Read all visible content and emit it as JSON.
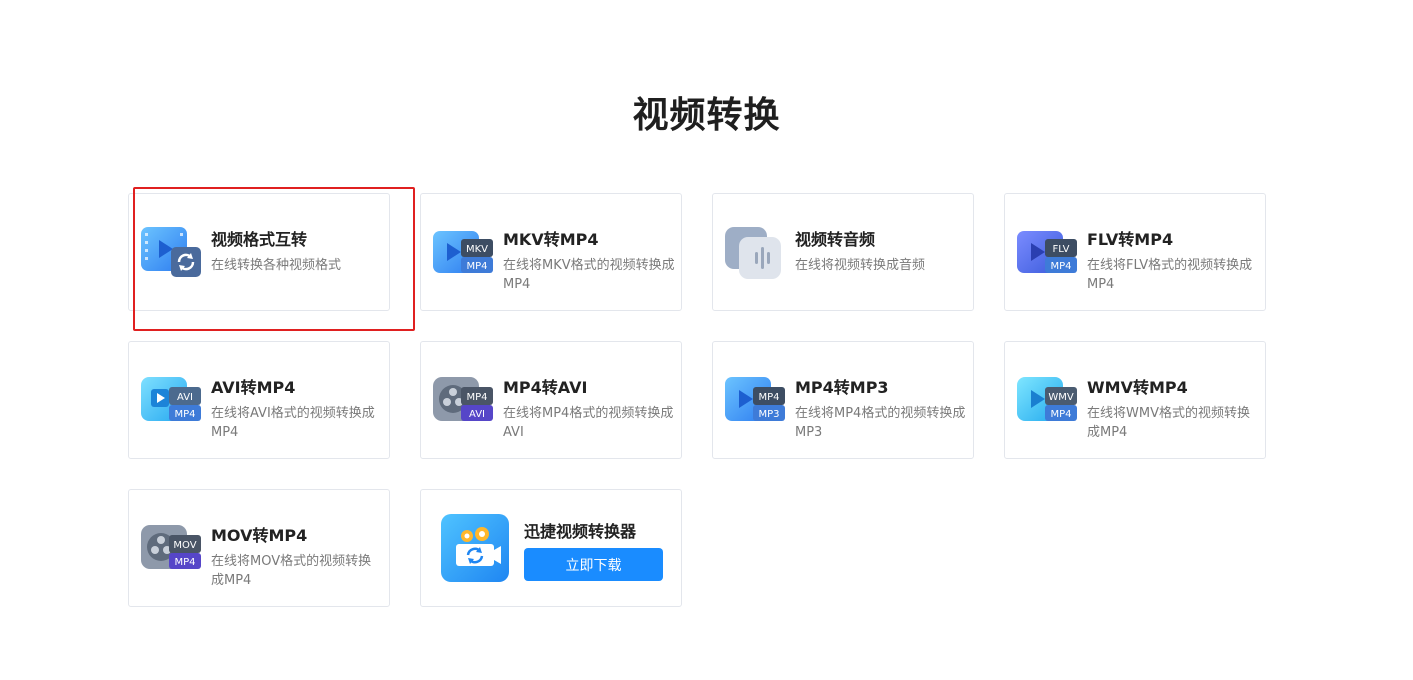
{
  "page": {
    "title": "视频转换"
  },
  "cards": [
    {
      "title": "视频格式互转",
      "desc": "在线转换各种视频格式",
      "icon": "video-convert-icon",
      "highlighted": true
    },
    {
      "title": "MKV转MP4",
      "desc": "在线将MKV格式的视频转换成MP4",
      "icon": "mkv-to-mp4-icon",
      "badge_top": "MKV",
      "badge_bottom": "MP4"
    },
    {
      "title": "视频转音频",
      "desc": "在线将视频转换成音频",
      "icon": "video-to-audio-icon"
    },
    {
      "title": "FLV转MP4",
      "desc": "在线将FLV格式的视频转换成MP4",
      "icon": "flv-to-mp4-icon",
      "badge_top": "FLV",
      "badge_bottom": "MP4"
    },
    {
      "title": "AVI转MP4",
      "desc": "在线将AVI格式的视频转换成MP4",
      "icon": "avi-to-mp4-icon",
      "badge_top": "AVI",
      "badge_bottom": "MP4"
    },
    {
      "title": "MP4转AVI",
      "desc": "在线将MP4格式的视频转换成AVI",
      "icon": "mp4-to-avi-icon",
      "badge_top": "MP4",
      "badge_bottom": "AVI"
    },
    {
      "title": "MP4转MP3",
      "desc": "在线将MP4格式的视频转换成MP3",
      "icon": "mp4-to-mp3-icon",
      "badge_top": "MP4",
      "badge_bottom": "MP3"
    },
    {
      "title": "WMV转MP4",
      "desc": "在线将WMV格式的视频转换成MP4",
      "icon": "wmv-to-mp4-icon",
      "badge_top": "WMV",
      "badge_bottom": "MP4"
    },
    {
      "title": "MOV转MP4",
      "desc": "在线将MOV格式的视频转换成MP4",
      "icon": "mov-to-mp4-icon",
      "badge_top": "MOV",
      "badge_bottom": "MP4"
    }
  ],
  "promo": {
    "title": "迅捷视频转换器",
    "button_label": "立即下载",
    "icon": "video-converter-app-icon"
  },
  "colors": {
    "accent": "#1a8cff",
    "highlight_border": "#e02020",
    "card_border": "#e3e6ec",
    "title_text": "#222222",
    "desc_text": "#7a7a7a"
  }
}
